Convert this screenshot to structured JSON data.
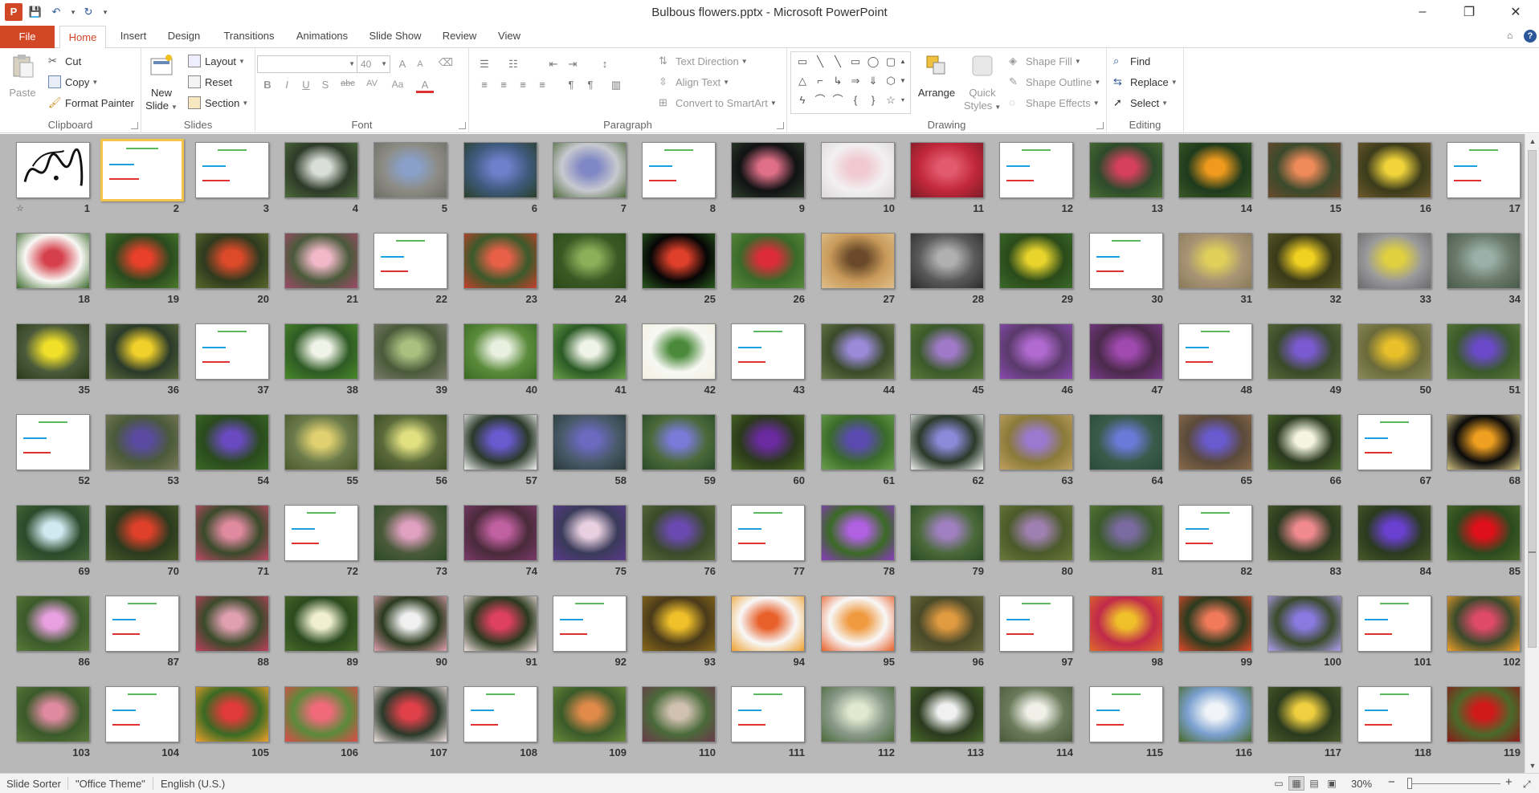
{
  "window": {
    "title": "Bulbous flowers.pptx - Microsoft PowerPoint",
    "app_letter": "P",
    "minimize_label": "–",
    "restore_label": "❐",
    "close_label": "✕"
  },
  "quick_access": {
    "save_icon": "💾",
    "undo_icon": "↶",
    "redo_icon": "↻",
    "dropdown_icon": "▾"
  },
  "tabs": [
    {
      "label": "File"
    },
    {
      "label": "Home"
    },
    {
      "label": "Insert"
    },
    {
      "label": "Design"
    },
    {
      "label": "Transitions"
    },
    {
      "label": "Animations"
    },
    {
      "label": "Slide Show"
    },
    {
      "label": "Review"
    },
    {
      "label": "View"
    }
  ],
  "ribbon_right": {
    "collapse_icon": "⌂",
    "help_label": "?"
  },
  "clipboard": {
    "group_label": "Clipboard",
    "paste": "Paste",
    "cut": "Cut",
    "copy": "Copy",
    "format_painter": "Format Painter"
  },
  "slides": {
    "group_label": "Slides",
    "new_slide_line1": "New",
    "new_slide_line2": "Slide",
    "layout": "Layout",
    "reset": "Reset",
    "section": "Section"
  },
  "font": {
    "group_label": "Font",
    "font_name": "",
    "font_size": "40",
    "grow": "A",
    "shrink": "A",
    "bold": "B",
    "italic": "I",
    "underline": "U",
    "shadow": "S",
    "strike": "abc",
    "spacing": "AV",
    "case": "Aa",
    "color": "A"
  },
  "paragraph": {
    "group_label": "Paragraph",
    "text_direction": "Text Direction",
    "align_text": "Align Text",
    "convert_smartart": "Convert to SmartArt"
  },
  "drawing": {
    "group_label": "Drawing",
    "arrange": "Arrange",
    "quick_styles_line1": "Quick",
    "quick_styles_line2": "Styles",
    "shape_fill": "Shape Fill",
    "shape_outline": "Shape Outline",
    "shape_effects": "Shape Effects"
  },
  "editing": {
    "group_label": "Editing",
    "find": "Find",
    "replace": "Replace",
    "select": "Select"
  },
  "slide_sorter": {
    "selected_slide": 2,
    "slides": [
      {
        "n": "1",
        "t": "calligraphy"
      },
      {
        "n": "2",
        "t": "text"
      },
      {
        "n": "3",
        "t": "text"
      },
      {
        "n": "4",
        "t": "photo",
        "c": [
          "#2d3a28",
          "#d9dfd8",
          "#4e6b3c"
        ]
      },
      {
        "n": "5",
        "t": "photo",
        "c": [
          "#8c8c84",
          "#8aa0c9",
          "#6e6e66"
        ]
      },
      {
        "n": "6",
        "t": "photo",
        "c": [
          "#3e5a7d",
          "#6f7fc9",
          "#2c3f2a"
        ]
      },
      {
        "n": "7",
        "t": "photo",
        "c": [
          "#c8c9cf",
          "#7f88c4",
          "#4f6b3c"
        ]
      },
      {
        "n": "8",
        "t": "text"
      },
      {
        "n": "9",
        "t": "photo",
        "c": [
          "#111214",
          "#de6f86",
          "#2d3d2a"
        ]
      },
      {
        "n": "10",
        "t": "photo",
        "c": [
          "#f2f0f2",
          "#f0c8d0",
          "#dcd8da"
        ]
      },
      {
        "n": "11",
        "t": "photo",
        "c": [
          "#c2283b",
          "#e25a6e",
          "#7d1c28"
        ]
      },
      {
        "n": "12",
        "t": "text"
      },
      {
        "n": "13",
        "t": "photo",
        "c": [
          "#2d4b2a",
          "#d6405a",
          "#4b6e34"
        ]
      },
      {
        "n": "14",
        "t": "photo",
        "c": [
          "#1e3a1c",
          "#ef9a1c",
          "#3b5a26"
        ]
      },
      {
        "n": "15",
        "t": "photo",
        "c": [
          "#3b4a2c",
          "#ef8a5a",
          "#6b4b2c"
        ]
      },
      {
        "n": "16",
        "t": "photo",
        "c": [
          "#3b3b1c",
          "#f0d43a",
          "#6e5a2a"
        ]
      },
      {
        "n": "17",
        "t": "text"
      },
      {
        "n": "18",
        "t": "photo",
        "c": [
          "#f8f8f4",
          "#d6404c",
          "#3b6a2c"
        ]
      },
      {
        "n": "19",
        "t": "photo",
        "c": [
          "#2a4a1e",
          "#e8402a",
          "#4b7a2c"
        ]
      },
      {
        "n": "20",
        "t": "photo",
        "c": [
          "#2e3a1e",
          "#dd4a2a",
          "#5a6a2c"
        ]
      },
      {
        "n": "21",
        "t": "photo",
        "c": [
          "#4a5a3a",
          "#f0b8c8",
          "#a04a6a"
        ]
      },
      {
        "n": "22",
        "t": "text"
      },
      {
        "n": "23",
        "t": "photo",
        "c": [
          "#3a5a2a",
          "#e86048",
          "#c8402c"
        ]
      },
      {
        "n": "24",
        "t": "photo",
        "c": [
          "#3a5a24",
          "#8ab05a",
          "#2a4a1a"
        ]
      },
      {
        "n": "25",
        "t": "photo",
        "c": [
          "#050505",
          "#e0402a",
          "#2a5a1e"
        ]
      },
      {
        "n": "26",
        "t": "photo",
        "c": [
          "#3a6a2a",
          "#dc2c3a",
          "#5a8a3a"
        ]
      },
      {
        "n": "27",
        "t": "photo",
        "c": [
          "#c89a5a",
          "#6a4a2a",
          "#e0c08a"
        ]
      },
      {
        "n": "28",
        "t": "photo",
        "c": [
          "#5a5a5a",
          "#b0b0b0",
          "#2c2c2c"
        ]
      },
      {
        "n": "29",
        "t": "photo",
        "c": [
          "#2a4a1a",
          "#e8d42c",
          "#3a6a2a"
        ]
      },
      {
        "n": "30",
        "t": "text"
      },
      {
        "n": "31",
        "t": "photo",
        "c": [
          "#a89474",
          "#e0d05a",
          "#8a7a5a"
        ]
      },
      {
        "n": "32",
        "t": "photo",
        "c": [
          "#3a3a1a",
          "#f0d020",
          "#5a5a2a"
        ]
      },
      {
        "n": "33",
        "t": "photo",
        "c": [
          "#9a9a9c",
          "#e0d040",
          "#6a6a6c"
        ]
      },
      {
        "n": "34",
        "t": "photo",
        "c": [
          "#6a7a6a",
          "#9ab0a8",
          "#4a5a4a"
        ]
      },
      {
        "n": "35",
        "t": "photo",
        "c": [
          "#4a5a3a",
          "#f0e02a",
          "#2a3a1a"
        ]
      },
      {
        "n": "36",
        "t": "photo",
        "c": [
          "#2a3a2a",
          "#f0d02a",
          "#5a6a3a"
        ]
      },
      {
        "n": "37",
        "t": "text"
      },
      {
        "n": "38",
        "t": "photo",
        "c": [
          "#2e5a24",
          "#f0f4e8",
          "#4a8a2a"
        ]
      },
      {
        "n": "39",
        "t": "photo",
        "c": [
          "#4a5a3a",
          "#a8c080",
          "#7a7a6a"
        ]
      },
      {
        "n": "40",
        "t": "photo",
        "c": [
          "#5a8a3a",
          "#e8f0e0",
          "#3a6a24"
        ]
      },
      {
        "n": "41",
        "t": "photo",
        "c": [
          "#2a5a24",
          "#f0f4e8",
          "#6aa04a"
        ]
      },
      {
        "n": "42",
        "t": "photo",
        "c": [
          "#f8f8f4",
          "#4a8a3a",
          "#f0f0e0"
        ]
      },
      {
        "n": "43",
        "t": "text"
      },
      {
        "n": "44",
        "t": "photo",
        "c": [
          "#3a4a2a",
          "#9a8ad8",
          "#6a7a4a"
        ]
      },
      {
        "n": "45",
        "t": "photo",
        "c": [
          "#3a5a2a",
          "#a07ac8",
          "#5a7a3a"
        ]
      },
      {
        "n": "46",
        "t": "photo",
        "c": [
          "#5a3a6a",
          "#b06ad0",
          "#8a4ab0"
        ]
      },
      {
        "n": "47",
        "t": "photo",
        "c": [
          "#4a2a4a",
          "#a04ab0",
          "#7a3a8a"
        ]
      },
      {
        "n": "48",
        "t": "text"
      },
      {
        "n": "49",
        "t": "photo",
        "c": [
          "#3a4a2a",
          "#7a5ad0",
          "#5a6a3a"
        ]
      },
      {
        "n": "50",
        "t": "photo",
        "c": [
          "#6a6a3a",
          "#e8c02a",
          "#8a8a5a"
        ]
      },
      {
        "n": "51",
        "t": "photo",
        "c": [
          "#3a5a2a",
          "#6a4ac8",
          "#5a7a3a"
        ]
      },
      {
        "n": "52",
        "t": "text"
      },
      {
        "n": "53",
        "t": "photo",
        "c": [
          "#4a5a3a",
          "#5a4aa0",
          "#7a7a5a"
        ]
      },
      {
        "n": "54",
        "t": "photo",
        "c": [
          "#2a4a1e",
          "#6a4ac0",
          "#3a6a24"
        ]
      },
      {
        "n": "55",
        "t": "photo",
        "c": [
          "#6a7a4a",
          "#e0d070",
          "#4a5a2a"
        ]
      },
      {
        "n": "56",
        "t": "photo",
        "c": [
          "#5a6a3a",
          "#e0e080",
          "#3a4a24"
        ]
      },
      {
        "n": "57",
        "t": "photo",
        "c": [
          "#2a3a2a",
          "#6a5ad0",
          "#f0f0f0"
        ]
      },
      {
        "n": "58",
        "t": "photo",
        "c": [
          "#4a5a6a",
          "#6a6ac0",
          "#2a3a3a"
        ]
      },
      {
        "n": "59",
        "t": "photo",
        "c": [
          "#4a6a3a",
          "#7a7ad8",
          "#2a4a2a"
        ]
      },
      {
        "n": "60",
        "t": "photo",
        "c": [
          "#2a3a1a",
          "#6a2aa0",
          "#4a6a24"
        ]
      },
      {
        "n": "61",
        "t": "photo",
        "c": [
          "#3a6a2a",
          "#5a4ab0",
          "#6aa04a"
        ]
      },
      {
        "n": "62",
        "t": "photo",
        "c": [
          "#2a3a2a",
          "#8a8ad8",
          "#f0f0f0"
        ]
      },
      {
        "n": "63",
        "t": "photo",
        "c": [
          "#8a7a3a",
          "#9a7ad0",
          "#c0a060"
        ]
      },
      {
        "n": "64",
        "t": "photo",
        "c": [
          "#3a5a4a",
          "#6a7ad8",
          "#2a4a3a"
        ]
      },
      {
        "n": "65",
        "t": "photo",
        "c": [
          "#5a4a3a",
          "#6a5ad0",
          "#8a6a4a"
        ]
      },
      {
        "n": "66",
        "t": "photo",
        "c": [
          "#2a3a1e",
          "#f4f4e0",
          "#4a6a2a"
        ]
      },
      {
        "n": "67",
        "t": "text"
      },
      {
        "n": "68",
        "t": "photo",
        "c": [
          "#0a0a0a",
          "#f0a020",
          "#d0c080"
        ]
      },
      {
        "n": "69",
        "t": "photo",
        "c": [
          "#2a4a2a",
          "#d0e8f0",
          "#4a6a3a"
        ]
      },
      {
        "n": "70",
        "t": "photo",
        "c": [
          "#2a3a1e",
          "#e0402a",
          "#4a5a2a"
        ]
      },
      {
        "n": "71",
        "t": "photo",
        "c": [
          "#3a4a2a",
          "#e08aa0",
          "#c04a6a"
        ]
      },
      {
        "n": "72",
        "t": "text"
      },
      {
        "n": "73",
        "t": "photo",
        "c": [
          "#4a5a3a",
          "#e0a0c0",
          "#2a4a24"
        ]
      },
      {
        "n": "74",
        "t": "photo",
        "c": [
          "#4a2a3a",
          "#c060a0",
          "#7a3a6a"
        ]
      },
      {
        "n": "75",
        "t": "photo",
        "c": [
          "#3a3a5a",
          "#e8d0e0",
          "#5a3a8a"
        ]
      },
      {
        "n": "76",
        "t": "photo",
        "c": [
          "#3a4a2a",
          "#6a4ab0",
          "#5a6a3a"
        ]
      },
      {
        "n": "77",
        "t": "text"
      },
      {
        "n": "78",
        "t": "photo",
        "c": [
          "#3a6a24",
          "#b060e0",
          "#8a3ac0"
        ]
      },
      {
        "n": "79",
        "t": "photo",
        "c": [
          "#4a6a3a",
          "#a080c0",
          "#2a4a24"
        ]
      },
      {
        "n": "80",
        "t": "photo",
        "c": [
          "#4a5a2a",
          "#a080b0",
          "#6a7a3a"
        ]
      },
      {
        "n": "81",
        "t": "photo",
        "c": [
          "#3a5a2a",
          "#7a6aa0",
          "#5a7a3a"
        ]
      },
      {
        "n": "82",
        "t": "text"
      },
      {
        "n": "83",
        "t": "photo",
        "c": [
          "#2a3a1e",
          "#f08a90",
          "#4a5a2a"
        ]
      },
      {
        "n": "84",
        "t": "photo",
        "c": [
          "#2a3a1e",
          "#6a40d0",
          "#4a5a2a"
        ]
      },
      {
        "n": "85",
        "t": "photo",
        "c": [
          "#2a4a1e",
          "#e0101a",
          "#4a6a2a"
        ]
      },
      {
        "n": "86",
        "t": "photo",
        "c": [
          "#3a5a2a",
          "#e8a0e0",
          "#5a7a3a"
        ]
      },
      {
        "n": "87",
        "t": "text"
      },
      {
        "n": "88",
        "t": "photo",
        "c": [
          "#3a4a2a",
          "#e0a0b0",
          "#c04060"
        ]
      },
      {
        "n": "89",
        "t": "photo",
        "c": [
          "#2a4a1e",
          "#f0f0d0",
          "#4a6a2a"
        ]
      },
      {
        "n": "90",
        "t": "photo",
        "c": [
          "#2a3a1e",
          "#f0f0f0",
          "#e0a0b0"
        ]
      },
      {
        "n": "91",
        "t": "photo",
        "c": [
          "#2a3a1e",
          "#e04060",
          "#f0e0e0"
        ]
      },
      {
        "n": "92",
        "t": "text"
      },
      {
        "n": "93",
        "t": "photo",
        "c": [
          "#4a3a1a",
          "#f0c02a",
          "#8a6a1a"
        ]
      },
      {
        "n": "94",
        "t": "photo",
        "c": [
          "#f8f8f8",
          "#e8602a",
          "#f0a030"
        ]
      },
      {
        "n": "95",
        "t": "photo",
        "c": [
          "#f8f8f8",
          "#f09a40",
          "#e8602a"
        ]
      },
      {
        "n": "96",
        "t": "photo",
        "c": [
          "#4a4a2a",
          "#e09a40",
          "#6a6a3a"
        ]
      },
      {
        "n": "97",
        "t": "text"
      },
      {
        "n": "98",
        "t": "photo",
        "c": [
          "#c02a4a",
          "#f0c02a",
          "#e06a2a"
        ]
      },
      {
        "n": "99",
        "t": "photo",
        "c": [
          "#2a3a1e",
          "#f07a5a",
          "#e04a2a"
        ]
      },
      {
        "n": "100",
        "t": "photo",
        "c": [
          "#3a4a2a",
          "#8a7ae0",
          "#b0a0f0"
        ]
      },
      {
        "n": "101",
        "t": "text"
      },
      {
        "n": "102",
        "t": "photo",
        "c": [
          "#3a4a2a",
          "#e04a6a",
          "#f0a02a"
        ]
      },
      {
        "n": "103",
        "t": "photo",
        "c": [
          "#3a5a2a",
          "#e08aa0",
          "#5a7a3a"
        ]
      },
      {
        "n": "104",
        "t": "text"
      },
      {
        "n": "105",
        "t": "photo",
        "c": [
          "#3a6a24",
          "#e03a3a",
          "#f0a02a"
        ]
      },
      {
        "n": "106",
        "t": "photo",
        "c": [
          "#5a8a3a",
          "#f06a7a",
          "#e04a4a"
        ]
      },
      {
        "n": "107",
        "t": "photo",
        "c": [
          "#2a3a2a",
          "#e0404a",
          "#f0e0e0"
        ]
      },
      {
        "n": "108",
        "t": "text"
      },
      {
        "n": "109",
        "t": "photo",
        "c": [
          "#3a5a2a",
          "#e08a4a",
          "#6a8a3a"
        ]
      },
      {
        "n": "110",
        "t": "photo",
        "c": [
          "#4a6a3a",
          "#d0c0b0",
          "#6a3a4a"
        ]
      },
      {
        "n": "111",
        "t": "text"
      },
      {
        "n": "112",
        "t": "photo",
        "c": [
          "#8a9a8a",
          "#e0e8d0",
          "#4a6a3a"
        ]
      },
      {
        "n": "113",
        "t": "photo",
        "c": [
          "#2a3a1e",
          "#f0f0f0",
          "#4a6a2a"
        ]
      },
      {
        "n": "114",
        "t": "photo",
        "c": [
          "#6a7a5a",
          "#f0f0e8",
          "#4a5a3a"
        ]
      },
      {
        "n": "115",
        "t": "text"
      },
      {
        "n": "116",
        "t": "photo",
        "c": [
          "#7aa0d0",
          "#f0f4f8",
          "#4a6a2a"
        ]
      },
      {
        "n": "117",
        "t": "photo",
        "c": [
          "#2a3a1e",
          "#f0d040",
          "#4a5a2a"
        ]
      },
      {
        "n": "118",
        "t": "text"
      },
      {
        "n": "119",
        "t": "photo",
        "c": [
          "#4a6a2a",
          "#d01a1a",
          "#8a1a1a"
        ]
      }
    ]
  },
  "status": {
    "view_name": "Slide Sorter",
    "theme": "\"Office Theme\"",
    "language": "English (U.S.)",
    "zoom": "30%",
    "zoom_out": "−",
    "zoom_in": "+"
  },
  "colors": {
    "accent": "#d24726",
    "sorter_bg": "#b8b8b8",
    "selection": "#f3c34a",
    "slide_title_text": "#5cb85c",
    "slide_cyan_bullet": "#1ba1e2",
    "slide_red_bullet": "#e03030"
  }
}
